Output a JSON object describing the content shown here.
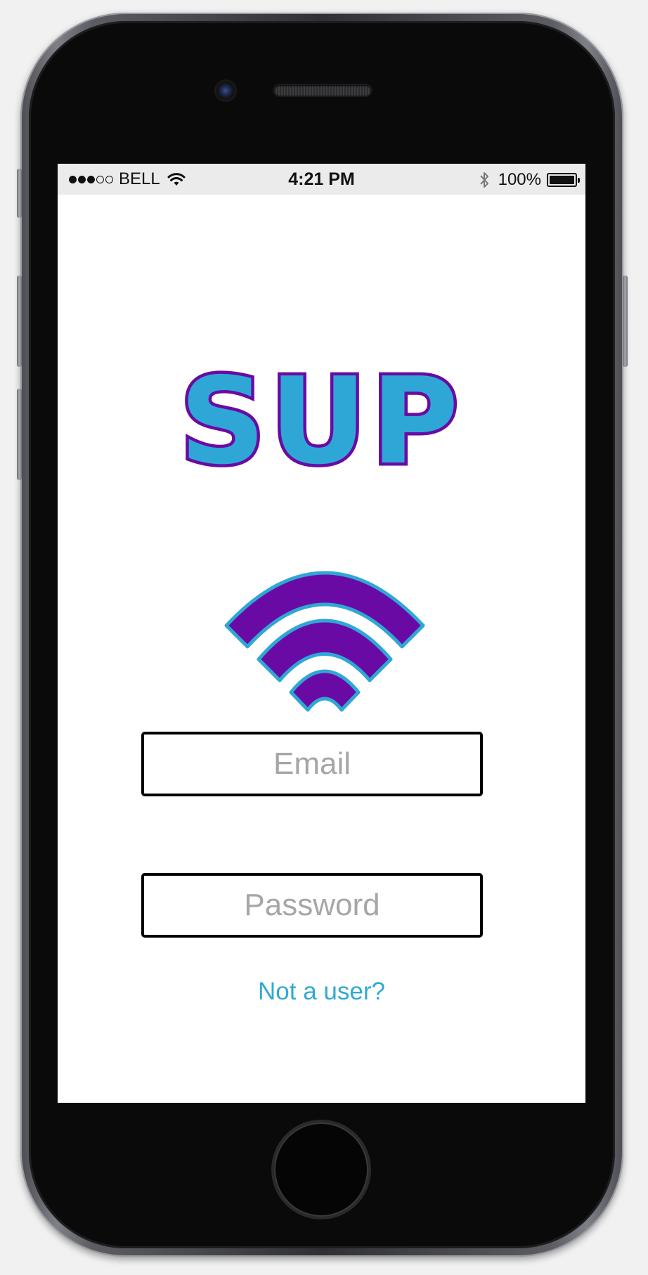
{
  "status_bar": {
    "carrier": "BELL",
    "time": "4:21 PM",
    "battery_percent": "100%",
    "signal_bars_filled": 3,
    "signal_bars_total": 5
  },
  "logo": {
    "text": "SUP"
  },
  "login": {
    "email_placeholder": "Email",
    "password_placeholder": "Password",
    "signup_link": "Not a user?"
  },
  "colors": {
    "logo_letter_fill": "#2fa7d6",
    "logo_outline": "#6a0aa4",
    "signal_arc_fill": "#6a0aa4",
    "signal_arc_outline": "#2fa7d6",
    "link_color": "#31a9d4",
    "status_bar_bg": "#ebebeb"
  },
  "icons": {
    "wifi": "wifi-icon",
    "bluetooth": "bluetooth-icon",
    "battery": "battery-icon"
  }
}
